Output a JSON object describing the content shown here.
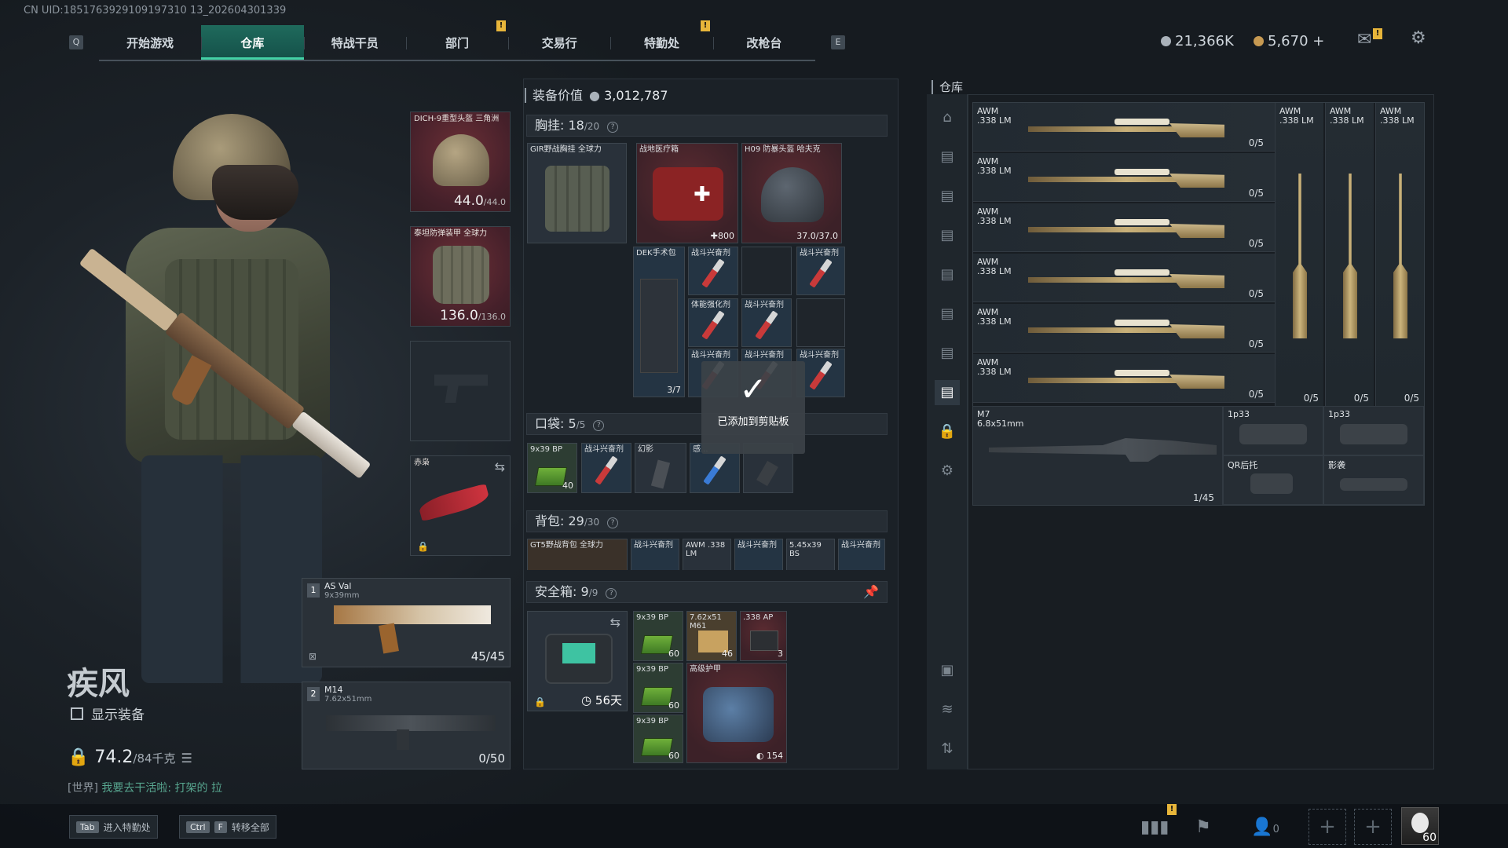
{
  "uid": "CN UID:1851763929109197310 13_202604301339",
  "header": {
    "key_left": "Q",
    "key_right": "E",
    "tabs": [
      "开始游戏",
      "仓库",
      "特战干员",
      "部门",
      "交易行",
      "特勤处",
      "改枪台"
    ],
    "currency1": "21,366K",
    "currency2": "5,670 +",
    "notice": "!"
  },
  "operator": {
    "name": "疾风",
    "show_equipment": "显示装备",
    "weight": "74.2",
    "weight_max": "/84千克",
    "chat_channel": "[世界]",
    "chat_text": "我要去干活啦: 打架的 拉"
  },
  "equipment": {
    "helmet": {
      "label": "DICH-9重型头盔 三角洲",
      "durability": "44.0",
      "max": "/44.0"
    },
    "armor": {
      "label": "泰坦防弹装甲 全球力",
      "durability": "136.0",
      "max": "/136.0"
    },
    "melee": {
      "label": "赤枭"
    },
    "primary": {
      "slot": "1",
      "name": "AS Val",
      "caliber": "9x39mm",
      "ammo": "45/45"
    },
    "secondary": {
      "slot": "2",
      "name": "M14",
      "caliber": "7.62x51mm",
      "ammo": "0/50"
    }
  },
  "middle": {
    "title": "装备价值",
    "value": "3,012,787",
    "chest": {
      "label": "胸挂:",
      "used": "18",
      "cap": "/20"
    },
    "chest_items": [
      {
        "label": "GIR野战胸挂 全球力"
      },
      {
        "label": "战地医疗箱",
        "val": "✚800"
      },
      {
        "label": "H09 防暴头盔 哈夫克",
        "val": "37.0/37.0"
      },
      {
        "label": "DEK手术包",
        "val": "3/7"
      },
      {
        "label": "战斗兴奋剂"
      },
      {
        "label": "战斗兴奋剂"
      },
      {
        "label": "体能强化剂"
      },
      {
        "label": "战斗兴奋剂"
      },
      {
        "label": "战斗兴奋剂"
      },
      {
        "label": "战斗兴奋剂"
      },
      {
        "label": "战斗兴奋剂"
      }
    ],
    "pocket": {
      "label": "口袋:",
      "used": "5",
      "cap": "/5"
    },
    "pocket_items": [
      {
        "label": "9x39 BP",
        "val": "40"
      },
      {
        "label": "战斗兴奋剂"
      },
      {
        "label": "幻影"
      },
      {
        "label": "感..."
      },
      {
        "label": ""
      }
    ],
    "backpack": {
      "label": "背包:",
      "used": "29",
      "cap": "/30"
    },
    "backpack_items": [
      "GT5野战背包 全球力",
      "战斗兴奋剂",
      "AWM .338 LM",
      "战斗兴奋剂",
      "5.45x39 BS",
      "战斗兴奋剂"
    ],
    "safebox": {
      "label": "安全箱:",
      "used": "9",
      "cap": "/9",
      "timer": "56天"
    },
    "safe_items": [
      {
        "label": "9x39 BP",
        "val": "60"
      },
      {
        "label": "7.62x51 M61",
        "val": "46"
      },
      {
        "label": ".338 AP",
        "val": "3"
      },
      {
        "label": "9x39 BP",
        "val": "60"
      },
      {
        "label": "高级护甲",
        "val": "154"
      },
      {
        "label": "9x39 BP",
        "val": "60"
      }
    ],
    "toast": "已添加到剪贴板"
  },
  "warehouse": {
    "title": "仓库",
    "awm_rows": [
      {
        "name": "AWM",
        "cal": ".338 LM",
        "cap": "0/5"
      },
      {
        "name": "AWM",
        "cal": ".338 LM",
        "cap": "0/5"
      },
      {
        "name": "AWM",
        "cal": ".338 LM",
        "cap": "0/5"
      },
      {
        "name": "AWM",
        "cal": ".338 LM",
        "cap": "0/5"
      },
      {
        "name": "AWM",
        "cal": ".338 LM",
        "cap": "0/5"
      },
      {
        "name": "AWM",
        "cal": ".338 LM",
        "cap": "0/5"
      }
    ],
    "awm_cols": [
      {
        "name": "AWM",
        "cal": ".338 LM",
        "cap": "0/5"
      },
      {
        "name": "AWM",
        "cal": ".338 LM",
        "cap": "0/5"
      },
      {
        "name": "AWM",
        "cal": ".338 LM",
        "cap": "0/5"
      }
    ],
    "m7": {
      "name": "M7",
      "cal": "6.8x51mm",
      "cap": "1/45"
    },
    "attachments": [
      "1p33",
      "1p33",
      "QR后托",
      "影袭"
    ]
  },
  "bottom": {
    "tab_key": "Tab",
    "tab_label": "进入特勤处",
    "ctrl_key": "Ctrl",
    "f_key": "F",
    "transfer_label": "转移全部",
    "friends": "0",
    "level": "60"
  },
  "colors": {
    "accent": "#43d1a6",
    "tab_active": "#1f6a5c",
    "item_red": "#5b2b31"
  }
}
